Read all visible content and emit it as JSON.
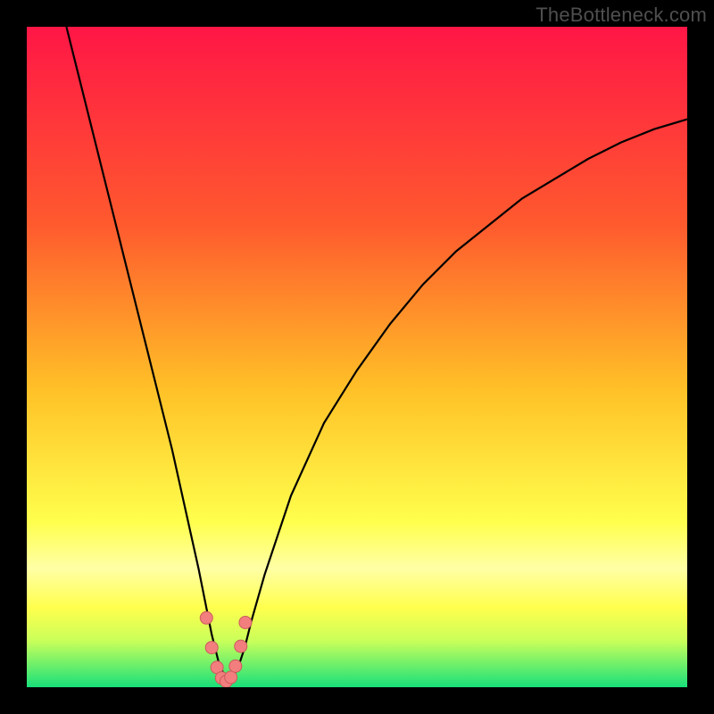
{
  "watermark": "TheBottleneck.com",
  "colors": {
    "frame": "#000000",
    "grad_top": "#ff1646",
    "grad_mid1": "#ff7a2b",
    "grad_mid2": "#ffd02b",
    "grad_mid3": "#ffff66",
    "grad_band": "#ffffa6",
    "grad_low": "#d7ff70",
    "grad_bot": "#18e07a",
    "curve": "#000000",
    "marker_fill": "#f27e7e",
    "marker_stroke": "#cc5c5c"
  },
  "gradient_stops": [
    {
      "offset": 0.0,
      "color": "#ff1646"
    },
    {
      "offset": 0.3,
      "color": "#ff5a2e"
    },
    {
      "offset": 0.55,
      "color": "#ffc127"
    },
    {
      "offset": 0.75,
      "color": "#ffff4d"
    },
    {
      "offset": 0.82,
      "color": "#ffffa6"
    },
    {
      "offset": 0.88,
      "color": "#ffff4d"
    },
    {
      "offset": 0.93,
      "color": "#c9ff5a"
    },
    {
      "offset": 1.0,
      "color": "#18e07a"
    }
  ],
  "chart_data": {
    "type": "line",
    "title": "",
    "xlabel": "",
    "ylabel": "",
    "xlim": [
      0,
      100
    ],
    "ylim": [
      0,
      100
    ],
    "series": [
      {
        "name": "bottleneck-curve",
        "x": [
          6,
          8,
          10,
          12,
          14,
          16,
          18,
          20,
          22,
          24,
          26,
          27,
          28,
          29,
          30,
          30.5,
          31,
          32,
          33,
          34,
          36,
          40,
          45,
          50,
          55,
          60,
          65,
          70,
          75,
          80,
          85,
          90,
          95,
          100
        ],
        "y": [
          100,
          92,
          84,
          76,
          68,
          60,
          52,
          44,
          36,
          27,
          18,
          13,
          8,
          4,
          1.5,
          0.8,
          1.2,
          3,
          6,
          10,
          17,
          29,
          40,
          48,
          55,
          61,
          66,
          70,
          74,
          77,
          80,
          82.5,
          84.5,
          86
        ]
      }
    ],
    "markers": {
      "name": "bottom-cluster",
      "x": [
        27.2,
        28.0,
        28.8,
        29.5,
        30.2,
        30.9,
        31.6,
        32.4,
        33.1
      ],
      "y": [
        10.5,
        6.0,
        3.0,
        1.4,
        0.9,
        1.5,
        3.2,
        6.2,
        9.8
      ]
    }
  }
}
